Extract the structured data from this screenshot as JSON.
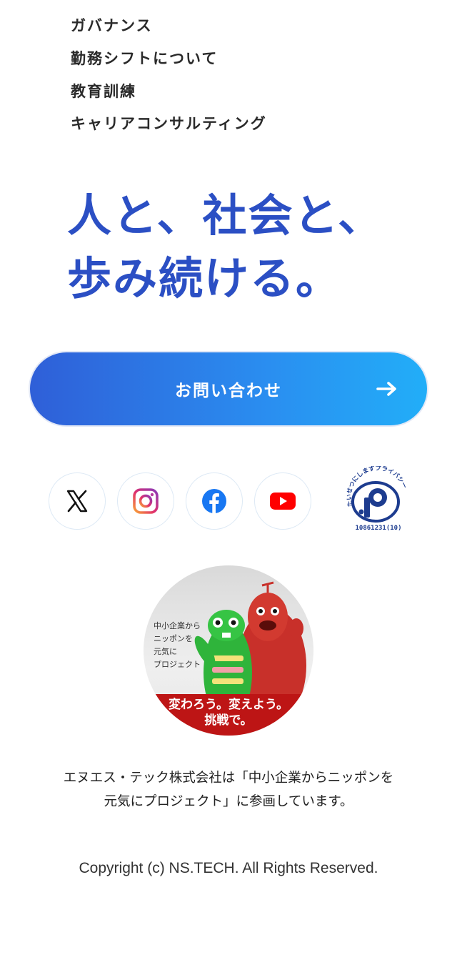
{
  "nav": {
    "items": [
      {
        "label": "ガバナンス"
      },
      {
        "label": "勤務シフトについて"
      },
      {
        "label": "教育訓練"
      },
      {
        "label": "キャリアコンサルティング"
      }
    ]
  },
  "tagline": {
    "line1": "人と、社会と、",
    "line2": "歩み続ける。"
  },
  "contact": {
    "label": "お問い合わせ"
  },
  "social": [
    "x-icon",
    "instagram-icon",
    "facebook-icon",
    "youtube-icon"
  ],
  "privacy_mark": {
    "arc_text": "たいせつにしますプライバシー",
    "number": "10861231(10)"
  },
  "campaign": {
    "sign_lines": [
      "中小企業から",
      "ニッポンを",
      "元気に",
      "プロジェクト"
    ],
    "banner_line1": "変わろう。変えよう。",
    "banner_line2": "挑戦で。"
  },
  "participation": {
    "line1": "エヌエス・テック株式会社は「中小企業からニッポンを",
    "line2": "元気にプロジェクト」に参画しています。"
  },
  "footer": {
    "copyright": "Copyright (c) NS.TECH. All Rights Reserved."
  },
  "colors": {
    "accent": "#2b4fc4",
    "button_start": "#2f5fd8",
    "button_end": "#22aef8",
    "banner": "#bd1515"
  }
}
